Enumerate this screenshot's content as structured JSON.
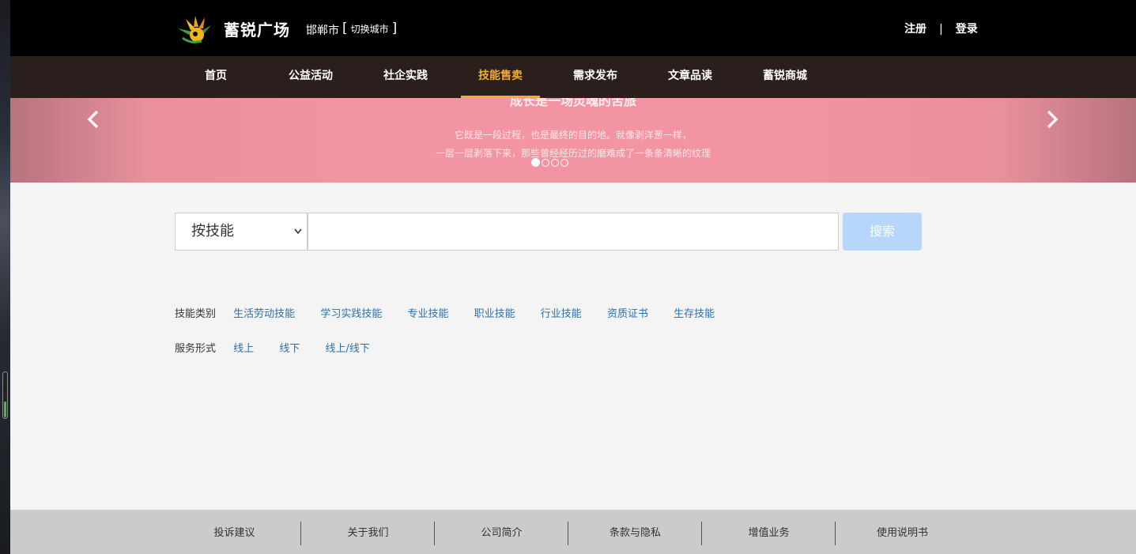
{
  "header": {
    "site_title": "蓄锐广场",
    "city": "邯郸市",
    "city_switch_open": "[",
    "city_switch_label": "切换城市",
    "city_switch_close": "]",
    "register": "注册",
    "separator": "|",
    "login": "登录"
  },
  "nav": {
    "items": [
      {
        "label": "首页"
      },
      {
        "label": "公益活动"
      },
      {
        "label": "社企实践"
      },
      {
        "label": "技能售卖",
        "active": true
      },
      {
        "label": "需求发布"
      },
      {
        "label": "文章品读"
      },
      {
        "label": "蓄锐商城"
      }
    ]
  },
  "banner": {
    "title": "成长是一场灵魂的苦旅",
    "line1": "它既是一段过程，也是最终的目的地。就像剥洋葱一样，",
    "line2": "一层一层剥落下来，那些曾经经历过的磨难成了一条条清晰的纹理",
    "prev_icon": "chevron-left-icon",
    "next_icon": "chevron-right-icon",
    "slide_count": 4,
    "active_slide": 1
  },
  "search": {
    "select_value": "按技能",
    "input_value": "",
    "button_label": "搜索"
  },
  "filters": {
    "skill_category": {
      "label": "技能类别",
      "options": [
        "生活劳动技能",
        "学习实践技能",
        "专业技能",
        "职业技能",
        "行业技能",
        "资质证书",
        "生存技能"
      ]
    },
    "service_mode": {
      "label": "服务形式",
      "options": [
        "线上",
        "线下",
        "线上/线下"
      ]
    }
  },
  "footer": {
    "items": [
      "投诉建议",
      "关于我们",
      "公司简介",
      "条款与隐私",
      "增值业务",
      "使用说明书"
    ]
  },
  "colors": {
    "header_bg": "#000000",
    "nav_bg": "#2a1f1d",
    "nav_active": "#f0b024",
    "banner_bg": "#f294a1",
    "link": "#2f6fa8",
    "search_button": "#b6d6fb",
    "footer_bg": "#cbcbcb"
  }
}
